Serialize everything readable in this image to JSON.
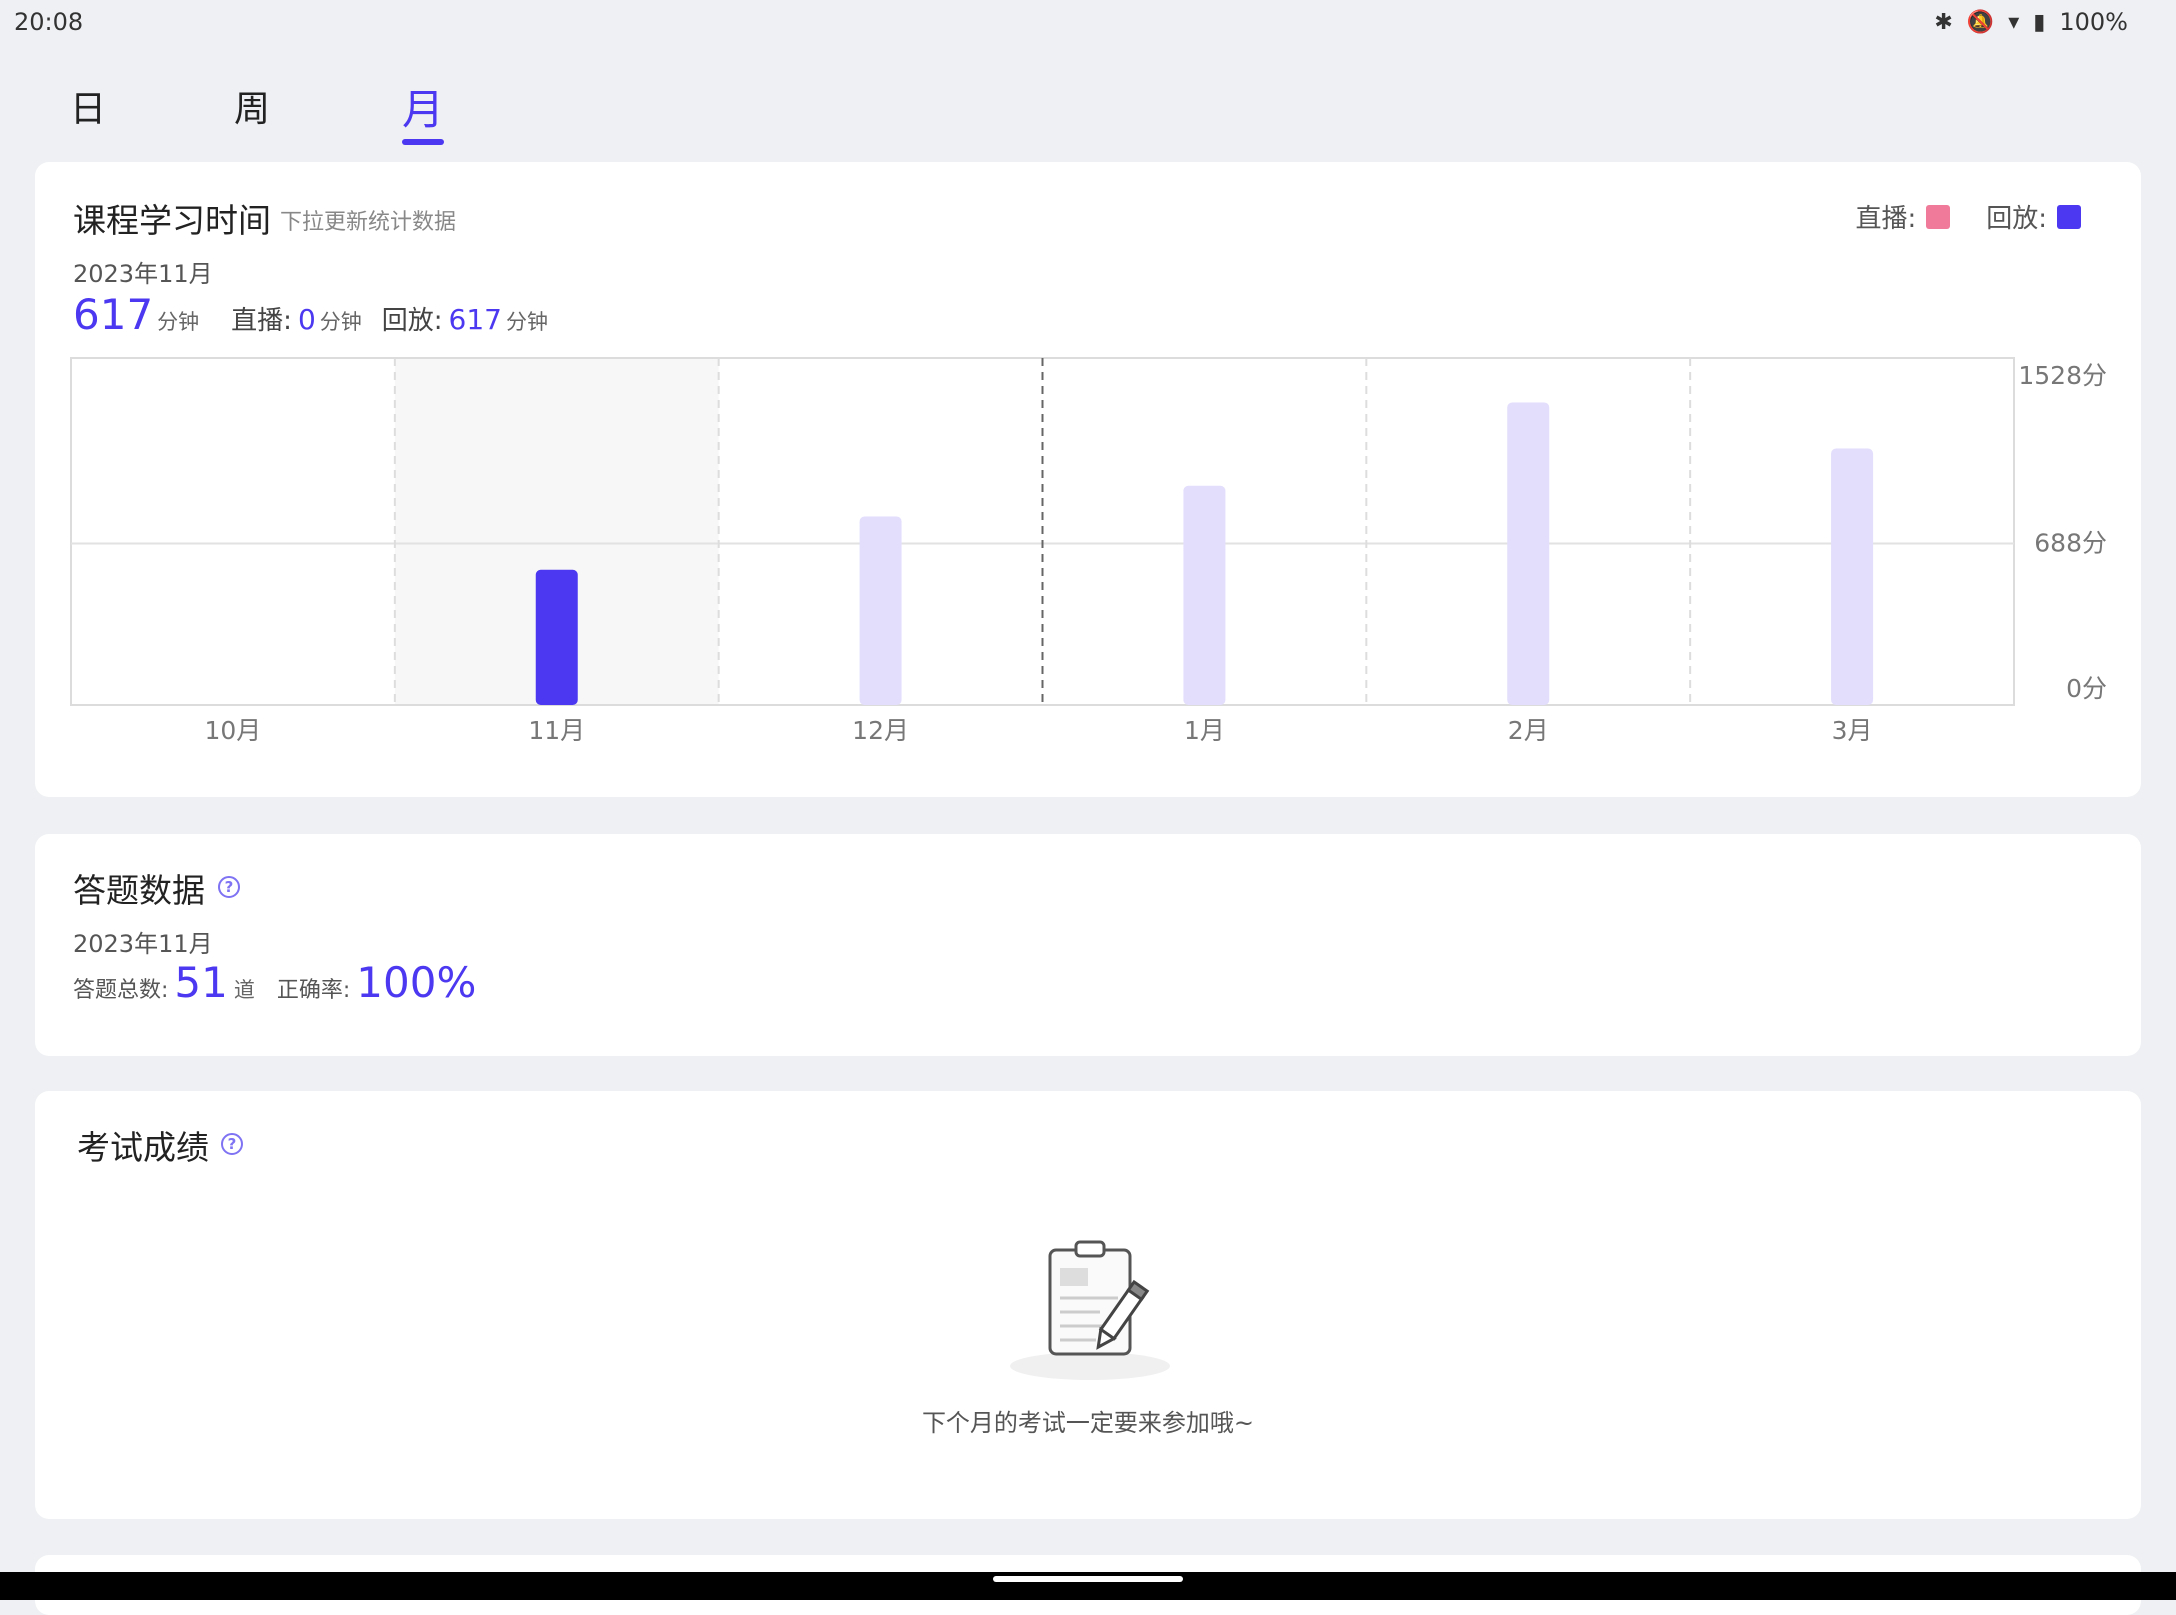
{
  "status": {
    "time": "20:08",
    "battery": "100%"
  },
  "tabs": [
    {
      "label": "日",
      "active": false
    },
    {
      "label": "周",
      "active": false
    },
    {
      "label": "月",
      "active": true
    }
  ],
  "study": {
    "title": "课程学习时间",
    "hint": "下拉更新统计数据",
    "legend": [
      {
        "label": "直播:",
        "color": "#f07a9a"
      },
      {
        "label": "回放:",
        "color": "#4b38f0"
      }
    ],
    "month": "2023年11月",
    "total": "617",
    "total_unit": "分钟",
    "live_label": "直播:",
    "live_value": "0",
    "live_unit": "分钟",
    "replay_label": "回放:",
    "replay_value": "617",
    "replay_unit": "分钟"
  },
  "chart_data": {
    "type": "bar",
    "categories": [
      "10月",
      "11月",
      "12月",
      "1月",
      "2月",
      "3月"
    ],
    "values": [
      0,
      617,
      860,
      1000,
      1380,
      1170
    ],
    "selected_index": 1,
    "y_ticks": [
      "0分",
      "688分",
      "1528分"
    ],
    "ylim": [
      0,
      1528
    ],
    "grid": true,
    "colors": {
      "selected": "#4b38f0",
      "other": "#e2defc",
      "highlight_bg": "#f7f7f7"
    }
  },
  "answers": {
    "title": "答题数据",
    "month": "2023年11月",
    "total_label": "答题总数:",
    "total_value": "51",
    "total_unit": "道",
    "accuracy_label": "正确率:",
    "accuracy_value": "100%"
  },
  "exam": {
    "title": "考试成绩",
    "empty_text": "下个月的考试一定要来参加哦~"
  }
}
